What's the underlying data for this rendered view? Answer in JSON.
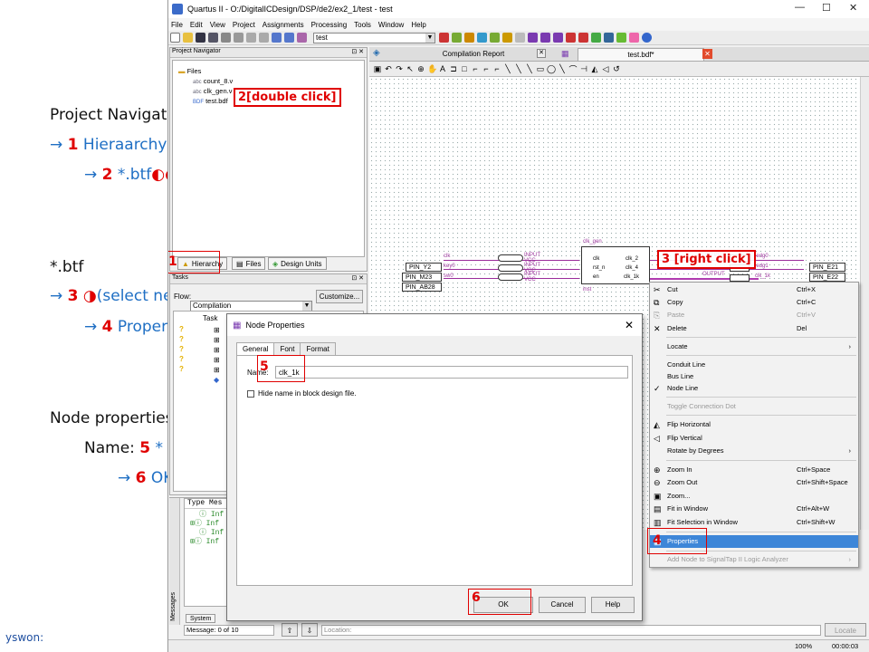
{
  "notes": {
    "l1": "Project Navigator",
    "l2_arrow": "→",
    "l2_num": "1",
    "l2_text": "Hieraarchy",
    "l3_arrow": "→",
    "l3_num": "2",
    "l3_text": "*.btf",
    "l3_icon": "◐◐",
    "l4": "*.btf",
    "l5_arrow": "→",
    "l5_num": "3",
    "l5_icon": "◑",
    "l5_text": "(select net)",
    "l6_arrow": "→",
    "l6_num": "4",
    "l6_text": "Properties",
    "l7": "Node properties",
    "l8_text": "Name:",
    "l8_num": "5",
    "l8_star": "*",
    "l9_arrow": "→",
    "l9_num": "6",
    "l9_text": "OK",
    "footer": "yswon:"
  },
  "window": {
    "title": "Quartus II - O:/DigitalICDesign/DSP/de2/ex2_1/test - test",
    "menu": [
      "File",
      "Edit",
      "View",
      "Project",
      "Assignments",
      "Processing",
      "Tools",
      "Window",
      "Help"
    ],
    "project_combo": "test"
  },
  "navigator": {
    "title": "Project Navigator",
    "files_root": "Files",
    "files": [
      "count_8.v",
      "clk_gen.v",
      "test.bdf"
    ],
    "tabs": [
      "Hierarchy",
      "Files",
      "Design Units"
    ]
  },
  "tasks": {
    "title": "Tasks",
    "flow_label": "Flow:",
    "flow_value": "Compilation",
    "customize": "Customize...",
    "col_task": "Task"
  },
  "messages": {
    "col_type": "Type",
    "col_message": "Mes",
    "rows": [
      "Inf",
      "Inf",
      "Inf",
      "Inf"
    ],
    "tab_system": "System",
    "status": "Message: 0 of 10",
    "location_placeholder": "Location:",
    "locate": "Locate",
    "side_label": "Messages"
  },
  "doc_tabs": {
    "compilation_report": "Compilation Report",
    "test_bdf": "test.bdf*"
  },
  "schematic": {
    "pins_in": [
      "PIN_Y2",
      "PIN_M23",
      "PIN_AB28"
    ],
    "pins_out": [
      "PIN_E21",
      "PIN_E22"
    ],
    "in_names": [
      "clk",
      "key0",
      "sw0"
    ],
    "input_tag": "INPUT",
    "output_tag": "OUTPUT",
    "vcc": "VCC",
    "block_name": "clk_gen",
    "block_inst": "inst",
    "block_ports_in": [
      "clk",
      "rst_n",
      "en"
    ],
    "block_ports_out": [
      "clk_2",
      "clk_4",
      "clk_1k"
    ],
    "out_names": [
      "ledg0",
      "ledg1"
    ]
  },
  "context_menu": {
    "cut": "Cut",
    "cut_sc": "Ctrl+X",
    "copy": "Copy",
    "copy_sc": "Ctrl+C",
    "paste": "Paste",
    "paste_sc": "Ctrl+V",
    "delete": "Delete",
    "delete_sc": "Del",
    "locate": "Locate",
    "conduit": "Conduit Line",
    "bus": "Bus Line",
    "node": "Node Line",
    "toggle": "Toggle Connection Dot",
    "fliph": "Flip Horizontal",
    "flipv": "Flip Vertical",
    "rotate": "Rotate by Degrees",
    "zoomin": "Zoom In",
    "zoomin_sc": "Ctrl+Space",
    "zoomout": "Zoom Out",
    "zoomout_sc": "Ctrl+Shift+Space",
    "zoom": "Zoom...",
    "fit": "Fit in Window",
    "fit_sc": "Ctrl+Alt+W",
    "fitsel": "Fit Selection in Window",
    "fitsel_sc": "Ctrl+Shift+W",
    "properties": "Properties",
    "signaltap": "Add Node to SignalTap II Logic Analyzer"
  },
  "dialog": {
    "title": "Node Properties",
    "tabs": [
      "General",
      "Font",
      "Format"
    ],
    "name_label": "Name:",
    "name_value": "clk_1k",
    "hide_label": "Hide name in block design file.",
    "ok": "OK",
    "cancel": "Cancel",
    "help": "Help"
  },
  "annotations": {
    "a1": "1",
    "a2": "2[double click]",
    "a3": "3 [right click]",
    "a4": "4",
    "a5": "5",
    "a6": "6"
  },
  "status": {
    "zoom": "100%",
    "time": "00:00:03"
  }
}
